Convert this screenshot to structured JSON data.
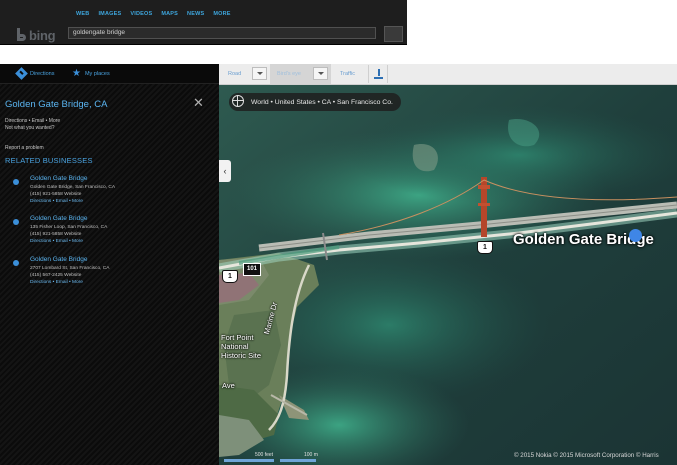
{
  "search": {
    "nav": [
      "WEB",
      "IMAGES",
      "VIDEOS",
      "MAPS",
      "NEWS",
      "MORE"
    ],
    "logo_text": "bing",
    "query": "goldengate bridge"
  },
  "panel": {
    "tabs": {
      "directions": "Directions",
      "my_places": "My places"
    },
    "title": "Golden Gate Bridge, CA",
    "links": "Directions • Email • More",
    "not_what": "Not what you wanted?",
    "report": "Report a problem",
    "related_title": "RELATED BUSINESSES",
    "businesses": [
      {
        "name": "Golden Gate Bridge",
        "address": "Golden Gate Bridge, San Francisco, CA",
        "phone": "(415) 921-5858 Website",
        "actions": "Directions • Email • More"
      },
      {
        "name": "Golden Gate Bridge",
        "address": "135 Fisher Loop, San Francisco, CA",
        "phone": "(415) 921-5858 Website",
        "actions": "Directions • Email • More"
      },
      {
        "name": "Golden Gate Bridge",
        "address": "2707 Lombard St, San Francisco, CA",
        "phone": "(415) 567-2425 Website",
        "actions": "Directions • Email • More"
      }
    ]
  },
  "toolbar": {
    "road": "Road",
    "birdseye": "Bird's eye",
    "traffic": "Traffic"
  },
  "map": {
    "breadcrumb": "World • United States • CA • San Francisco Co.",
    "bridge_label": "Golden Gate Bridge",
    "route_1": "1",
    "route_101": "101",
    "fort_point": "Fort Point\nNational\nHistoric Site",
    "marine_dr": "Marine Dr",
    "ave": "Ave",
    "scale_feet": "500 feet",
    "scale_m": "100 m",
    "copyright": "© 2015 Nokia   © 2015 Microsoft Corporation   © Harris"
  },
  "colors": {
    "panel_bg": "#0b0b0b",
    "link_blue": "#4aa3e0",
    "water": "#21403e"
  }
}
